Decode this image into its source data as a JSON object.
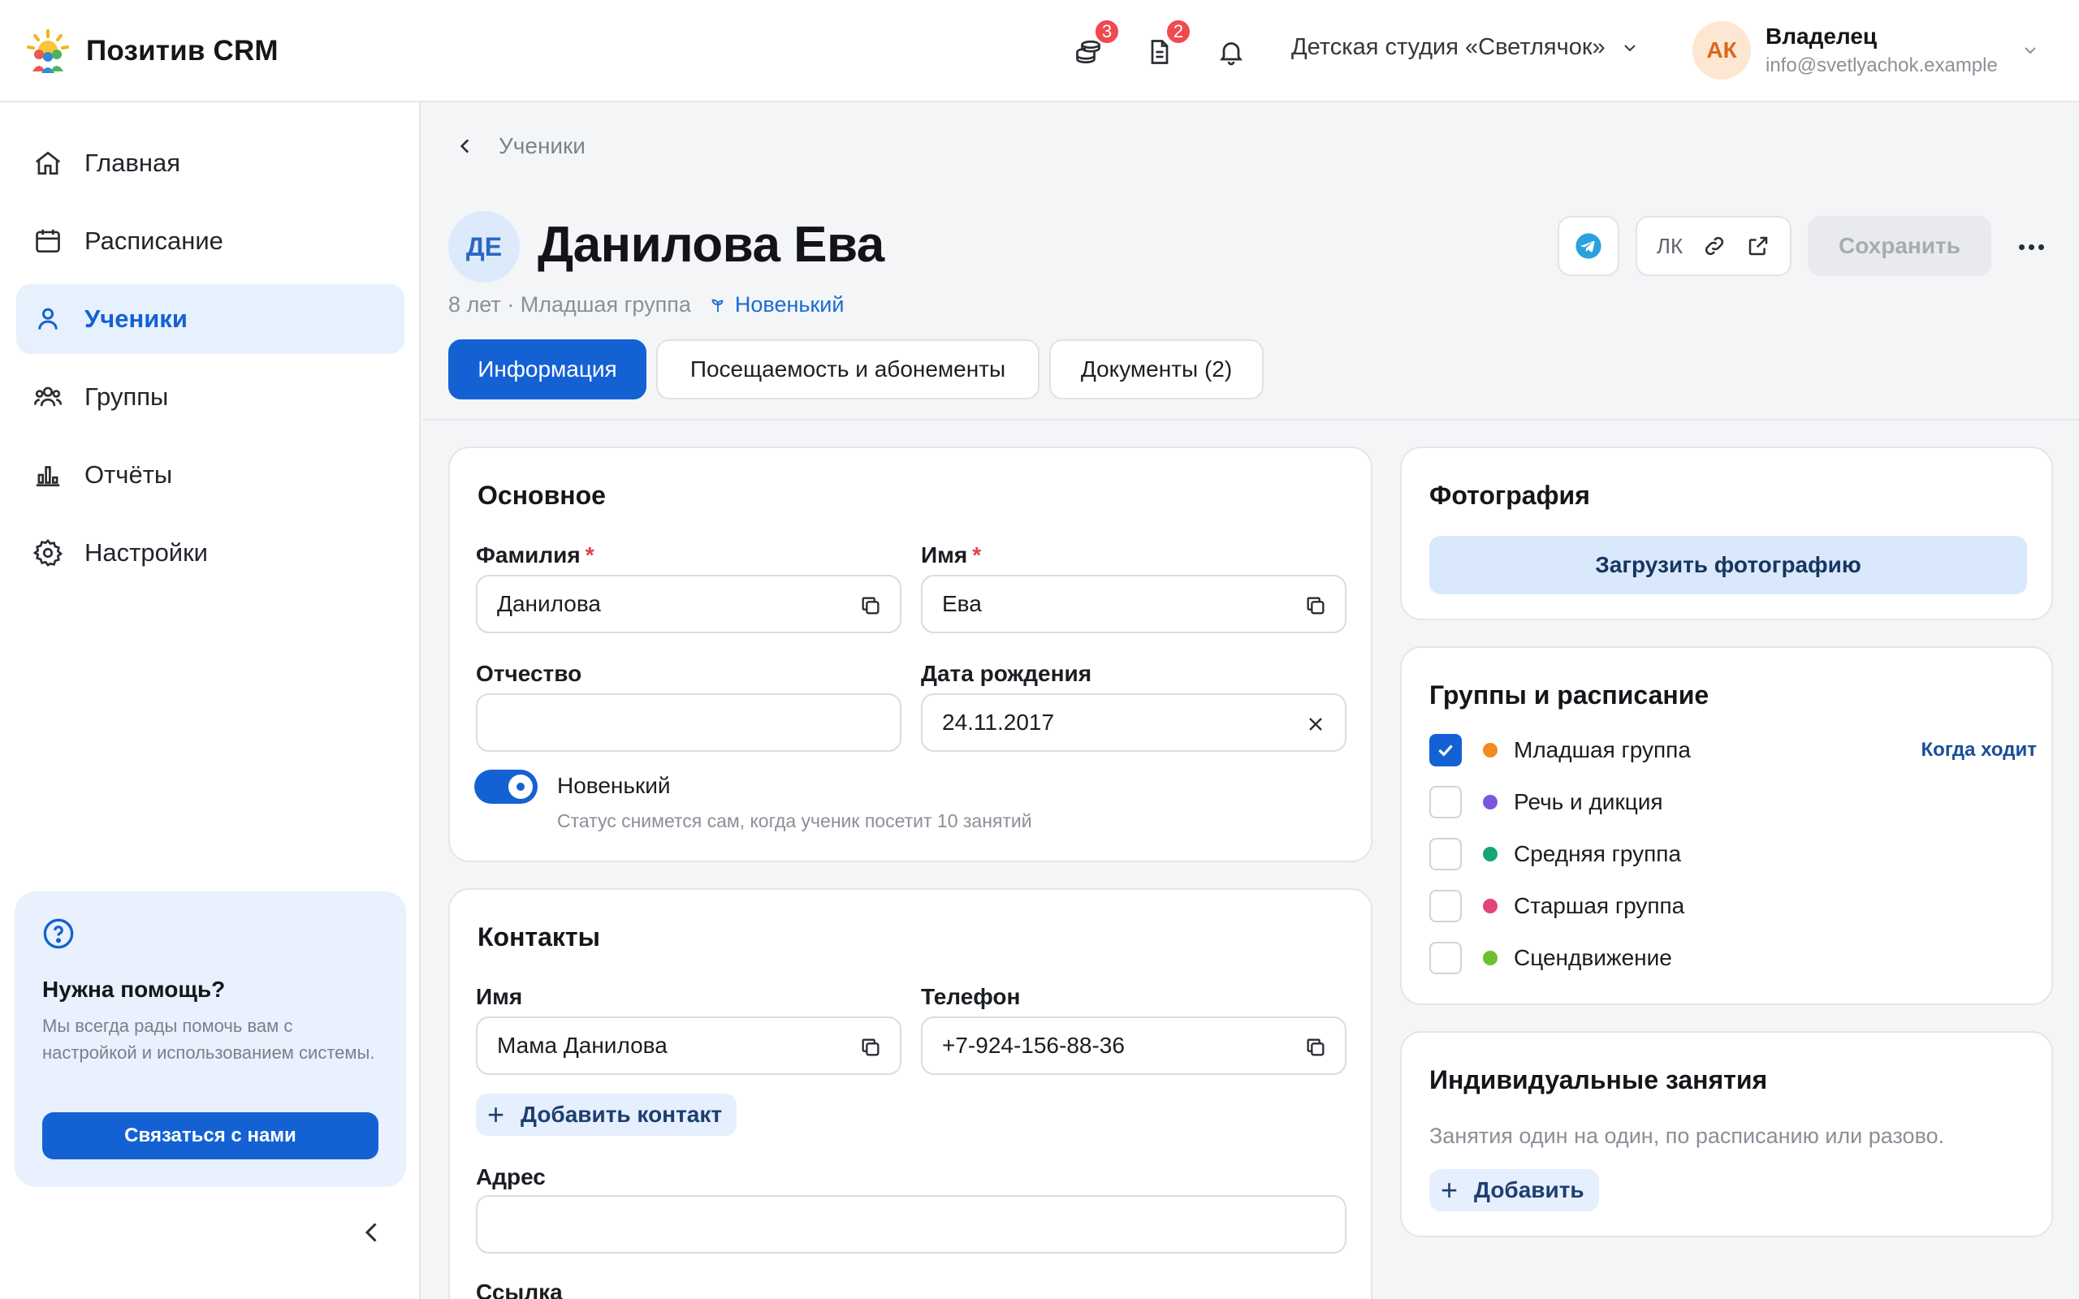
{
  "app": {
    "title": "Позитив CRM"
  },
  "header": {
    "badges": {
      "payments": "3",
      "documents": "2"
    },
    "org": "Детская студия «Светлячок»",
    "user": {
      "initials": "АК",
      "role": "Владелец",
      "email": "info@svetlyachok.example"
    }
  },
  "sidebar": {
    "items": [
      {
        "label": "Главная",
        "icon": "home-icon"
      },
      {
        "label": "Расписание",
        "icon": "calendar-icon"
      },
      {
        "label": "Ученики",
        "icon": "user-icon"
      },
      {
        "label": "Группы",
        "icon": "users-icon"
      },
      {
        "label": "Отчёты",
        "icon": "chart-icon"
      },
      {
        "label": "Настройки",
        "icon": "gear-icon"
      }
    ],
    "help": {
      "title": "Нужна помощь?",
      "text": "Мы всегда рады помочь вам с настройкой и использованием системы.",
      "button": "Связаться с нами"
    }
  },
  "breadcrumb": {
    "label": "Ученики"
  },
  "student": {
    "initials": "ДЕ",
    "name": "Данилова Ева",
    "meta": "8 лет · Младшая группа",
    "tag": "Новенький"
  },
  "actions": {
    "lk_label": "ЛК",
    "save": "Сохранить"
  },
  "tabs": [
    {
      "label": "Информация"
    },
    {
      "label": "Посещаемость и абонементы"
    },
    {
      "label": "Документы (2)"
    }
  ],
  "basic": {
    "title": "Основное",
    "surname_label": "Фамилия",
    "surname": "Данилова",
    "name_label": "Имя",
    "name": "Ева",
    "patronymic_label": "Отчество",
    "patronymic": "",
    "birth_label": "Дата рождения",
    "birth": "24.11.2017",
    "newbie_label": "Новенький",
    "newbie_on": true,
    "newbie_hint": "Статус снимется сам, когда ученик посетит 10 занятий",
    "required_mark": "*"
  },
  "contacts": {
    "title": "Контакты",
    "name_label": "Имя",
    "name": "Мама Данилова",
    "phone_label": "Телефон",
    "phone": "+7-924-156-88-36",
    "add": "Добавить контакт",
    "address_label": "Адрес",
    "address": "",
    "link_label": "Ссылка"
  },
  "photo": {
    "title": "Фотография",
    "button": "Загрузить фотографию"
  },
  "groups": {
    "title": "Группы и расписание",
    "when_label": "Когда ходит",
    "items": [
      {
        "name": "Младшая группа",
        "color": "#f28a1f",
        "checked": true
      },
      {
        "name": "Речь и дикция",
        "color": "#7b57e0",
        "checked": false
      },
      {
        "name": "Средняя группа",
        "color": "#17a673",
        "checked": false
      },
      {
        "name": "Старшая группа",
        "color": "#e0457b",
        "checked": false
      },
      {
        "name": "Сцендвижение",
        "color": "#6cc12e",
        "checked": false
      }
    ]
  },
  "individual": {
    "title": "Индивидуальные занятия",
    "text": "Занятия один на один, по расписанию или разово.",
    "add": "Добавить"
  },
  "colors": {
    "accent": "#1461d4",
    "danger": "#f0494f"
  }
}
